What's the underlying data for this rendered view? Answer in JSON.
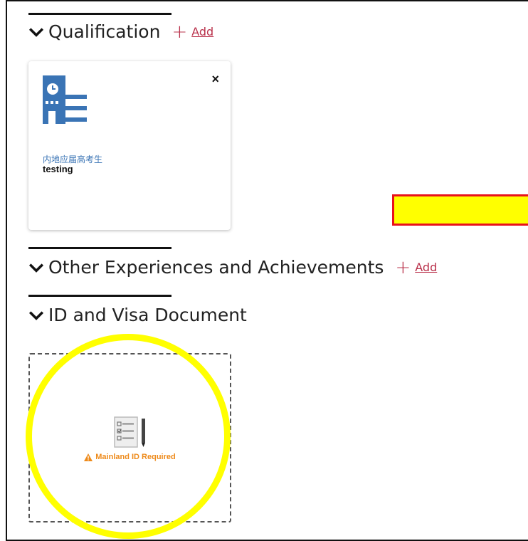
{
  "sections": {
    "qualification": {
      "title": "Qualification",
      "add_label": "Add"
    },
    "other_experiences": {
      "title": "Other Experiences and Achievements",
      "add_label": "Add"
    },
    "id_visa": {
      "title": "ID and Visa Document"
    }
  },
  "qualification_card": {
    "close_glyph": "×",
    "category": "内地应届高考生",
    "name": "testing",
    "icon": "school-building-icon"
  },
  "id_document_card": {
    "icon": "document-checklist-icon",
    "warning_text": "Mainland ID Required",
    "warning_icon": "warning-triangle-icon"
  },
  "colors": {
    "accent_link": "#b9304a",
    "icon_blue": "#3a74b5",
    "warning_orange": "#ee8a1a",
    "annotation_yellow": "#ffff00",
    "annotation_red": "#e8121c"
  }
}
